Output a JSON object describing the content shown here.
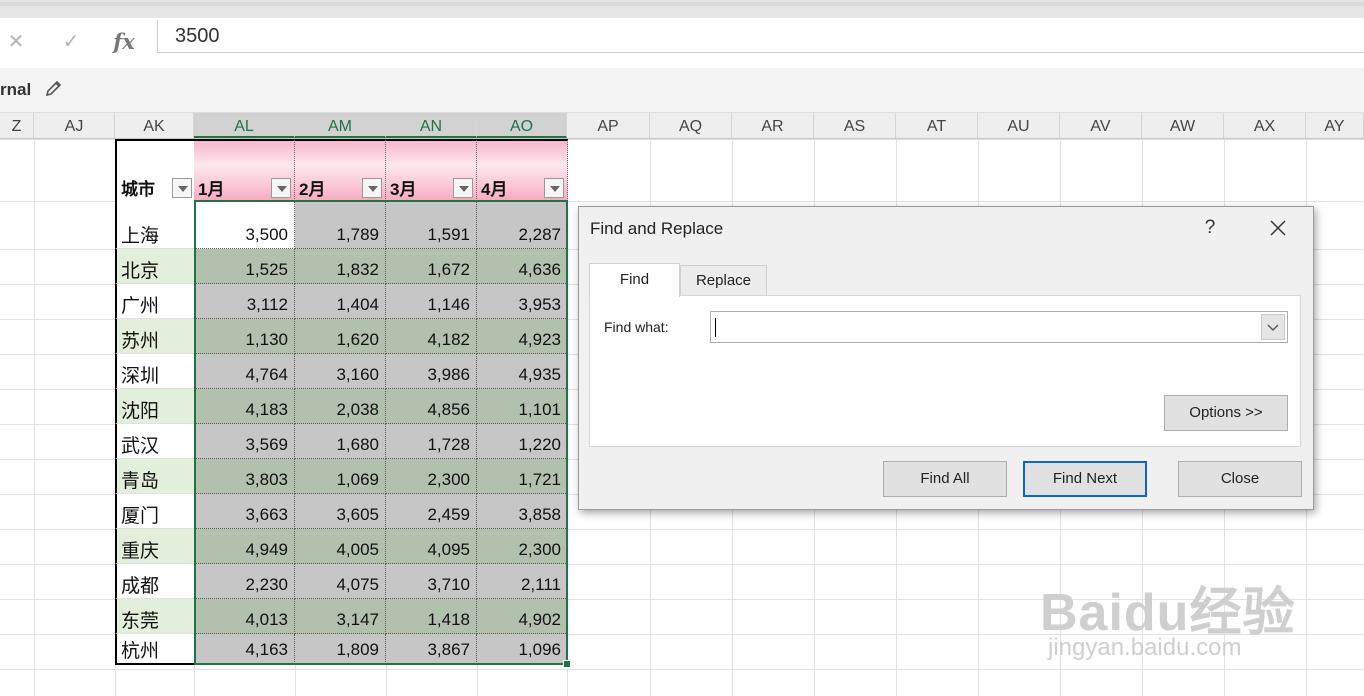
{
  "formula_bar": {
    "cancel_icon": "close-icon",
    "enter_icon": "check-icon",
    "fx_label": "fx",
    "value": "3500"
  },
  "sheet_view": {
    "name": "rnal",
    "edit_icon": "pencil-icon"
  },
  "columns": [
    "Z",
    "AJ",
    "AK",
    "AL",
    "AM",
    "AN",
    "AO",
    "AP",
    "AQ",
    "AR",
    "AS",
    "AT",
    "AU",
    "AV",
    "AW",
    "AX",
    "AY"
  ],
  "selected_columns": [
    "AL",
    "AM",
    "AN",
    "AO"
  ],
  "table": {
    "headers": [
      "城市",
      "1月",
      "2月",
      "3月",
      "4月"
    ],
    "rows": [
      {
        "city": "上海",
        "values": [
          "3,500",
          "1,789",
          "1,591",
          "2,287"
        ]
      },
      {
        "city": "北京",
        "values": [
          "1,525",
          "1,832",
          "1,672",
          "4,636"
        ]
      },
      {
        "city": "广州",
        "values": [
          "3,112",
          "1,404",
          "1,146",
          "3,953"
        ]
      },
      {
        "city": "苏州",
        "values": [
          "1,130",
          "1,620",
          "4,182",
          "4,923"
        ]
      },
      {
        "city": "深圳",
        "values": [
          "4,764",
          "3,160",
          "3,986",
          "4,935"
        ]
      },
      {
        "city": "沈阳",
        "values": [
          "4,183",
          "2,038",
          "4,856",
          "1,101"
        ]
      },
      {
        "city": "武汉",
        "values": [
          "3,569",
          "1,680",
          "1,728",
          "1,220"
        ]
      },
      {
        "city": "青岛",
        "values": [
          "3,803",
          "1,069",
          "2,300",
          "1,721"
        ]
      },
      {
        "city": "厦门",
        "values": [
          "3,663",
          "3,605",
          "2,459",
          "3,858"
        ]
      },
      {
        "city": "重庆",
        "values": [
          "4,949",
          "4,005",
          "4,095",
          "2,300"
        ]
      },
      {
        "city": "成都",
        "values": [
          "2,230",
          "4,075",
          "3,710",
          "2,111"
        ]
      },
      {
        "city": "东莞",
        "values": [
          "4,013",
          "3,147",
          "1,418",
          "4,902"
        ]
      },
      {
        "city": "杭州",
        "values": [
          "4,163",
          "1,809",
          "3,867",
          "1,096"
        ]
      }
    ]
  },
  "dialog": {
    "title": "Find and Replace",
    "help": "?",
    "tabs": {
      "find": "Find",
      "replace": "Replace"
    },
    "find_label": "Find what:",
    "find_value": "",
    "options_label": "Options >>",
    "find_all_label": "Find All",
    "find_next_label": "Find Next",
    "close_label": "Close"
  },
  "watermark": {
    "brand": "Baidu经验",
    "url": "jingyan.baidu.com"
  },
  "colors": {
    "selection_green": "#217346",
    "selected_fill_gray": "#c6c6c6",
    "selected_fill_green": "#b2c0ae",
    "city_alt_fill": "#e2efda",
    "header_pink": "#f7b6cc"
  }
}
